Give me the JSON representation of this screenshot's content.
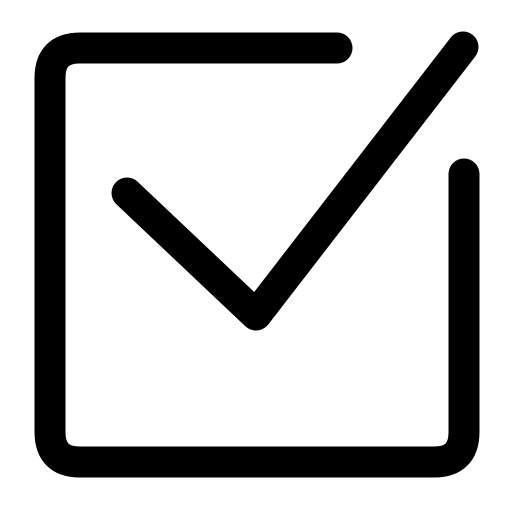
{
  "icon": {
    "name": "checkbox-checked-icon",
    "stroke_color": "#000000",
    "background_color": "#ffffff"
  }
}
